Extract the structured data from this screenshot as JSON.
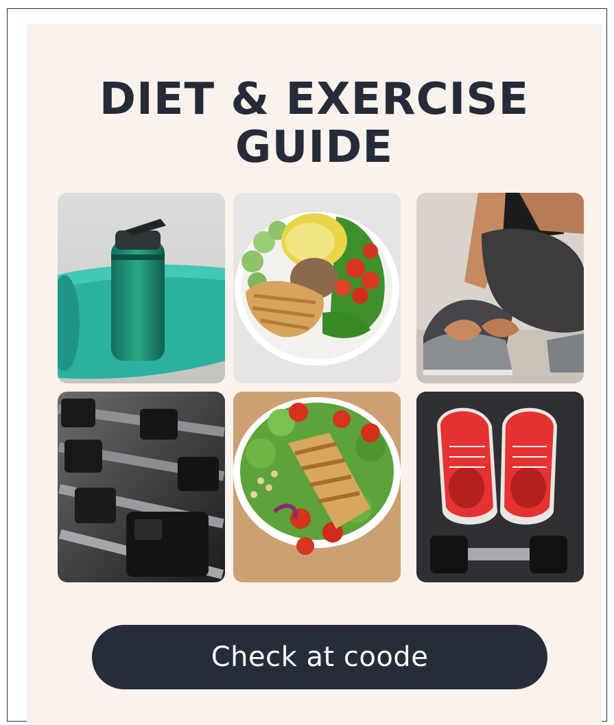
{
  "poster": {
    "title_line1": "DIET & EXERCISE",
    "title_line2": "GUIDE",
    "cta_label": "Check at coode"
  },
  "colors": {
    "background": "#faf2ec",
    "title": "#252b38",
    "button": "#262c39",
    "button_text": "#ffffff"
  },
  "images": [
    "water-bottle-and-yoga-mat",
    "chicken-avocado-bowl",
    "person-tying-shoelaces",
    "dumbbell-rack",
    "chicken-salad-bowl",
    "red-sneakers-and-dumbbell"
  ]
}
